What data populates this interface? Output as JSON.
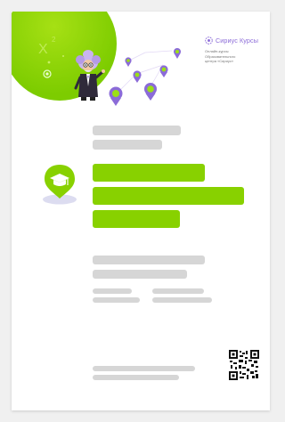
{
  "brand": {
    "logo_text": "Сириус Курсы",
    "subtitle_lines": [
      "Онлайн-курсы",
      "Образовательного",
      "центра «Сириус»"
    ]
  },
  "decoration": {
    "formula_text": "X",
    "formula_exponent": "2"
  },
  "icons": {
    "course": "graduation-cap-icon",
    "qr": "qr-code-icon",
    "mascot": "professor-mascot-icon",
    "pins": "map-pin-icon"
  },
  "colors": {
    "accent_green": "#88d100",
    "brand_purple": "#8b6bd8",
    "placeholder_gray": "#d6d6d6"
  }
}
